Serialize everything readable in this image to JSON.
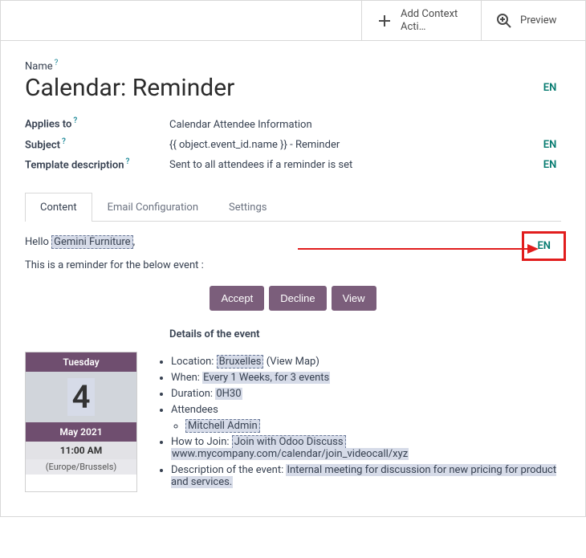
{
  "toolbar": {
    "add_context_label": "Add Context Acti…",
    "preview_label": "Preview"
  },
  "fields": {
    "name_label": "Name",
    "name_value": "Calendar: Reminder",
    "applies_label": "Applies to",
    "applies_value": "Calendar Attendee Information",
    "subject_label": "Subject",
    "subject_value": "{{ object.event_id.name }} - Reminder",
    "desc_label": "Template description",
    "desc_value": "Sent to all attendees if a reminder is set"
  },
  "lang": "EN",
  "tabs": {
    "content": "Content",
    "email_config": "Email Configuration",
    "settings": "Settings"
  },
  "body": {
    "hello_prefix": "Hello ",
    "hello_name": "Gemini Furniture",
    "hello_suffix": ",",
    "reminder_text": "This is a reminder for the below event :",
    "btn_accept": "Accept",
    "btn_decline": "Decline",
    "btn_view": "View",
    "details_heading": "Details of the event"
  },
  "minical": {
    "weekday": "Tuesday",
    "day": "4",
    "month": "May 2021",
    "time": "11:00 AM",
    "tz": "(Europe/Brussels)"
  },
  "details": {
    "location_label": "Location: ",
    "location_value": "Bruxelles",
    "location_map": " (View Map)",
    "when_label": "When: ",
    "when_value": "Every 1 Weeks, for 3 events",
    "duration_label": "Duration: ",
    "duration_value": "0H30",
    "attendees_label": "Attendees",
    "attendee_1": "Mitchell Admin",
    "howjoin_label": "How to Join: ",
    "howjoin_value": "Join with Odoo Discuss",
    "howjoin_url": "www.mycompany.com/calendar/join_videocall/xyz",
    "desc_label": "Description of the event: ",
    "desc_value": "Internal meeting for discussion for new pricing for product and services."
  }
}
